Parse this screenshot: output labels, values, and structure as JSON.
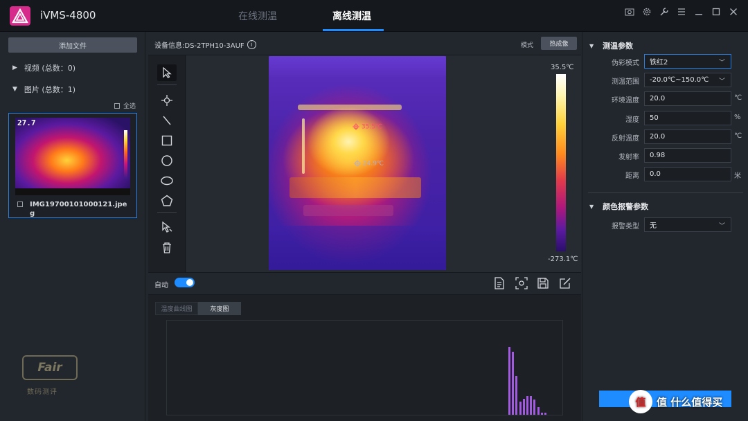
{
  "app": {
    "title": "iVMS-4800",
    "tabs": [
      {
        "label": "在线测温",
        "active": false
      },
      {
        "label": "离线测温",
        "active": true
      }
    ],
    "window_icons": [
      "camera-icon",
      "gear-icon",
      "wrench-icon",
      "menu-icon",
      "minimize-icon",
      "maximize-icon",
      "close-icon"
    ]
  },
  "left": {
    "add_file": "添加文件",
    "video_group": "视频 (总数：0)",
    "image_group": "图片 (总数：1)",
    "select_all": "全选",
    "thumbnail": {
      "temp": "27.7",
      "filename": "IMG19700101000121.jpeg"
    },
    "watermark": {
      "title": "Fair",
      "subtitle": "数码测评"
    }
  },
  "center": {
    "device_info": "设备信息:DS-2TPH10-3AUF",
    "mode_label": "模式",
    "thermal_button": "热成像",
    "scale": {
      "max": "35.5℃",
      "min": "-273.1℃"
    },
    "markers": [
      {
        "label": "35.5℃"
      },
      {
        "label": "24.9℃"
      }
    ],
    "auto_label": "自动",
    "auto_on": true,
    "hist_tabs": [
      "温度曲线图",
      "灰度图"
    ],
    "histogram_values": [
      72,
      67,
      41,
      14,
      17,
      20,
      20,
      16,
      8,
      2,
      2
    ]
  },
  "right": {
    "measure_title": "测温参数",
    "params": [
      {
        "label": "伪彩模式",
        "value": "铁红2",
        "type": "select",
        "unit": ""
      },
      {
        "label": "测温范围",
        "value": "-20.0℃~150.0℃",
        "type": "select",
        "unit": ""
      },
      {
        "label": "环境温度",
        "value": "20.0",
        "type": "input",
        "unit": "℃"
      },
      {
        "label": "湿度",
        "value": "50",
        "type": "input",
        "unit": "%"
      },
      {
        "label": "反射温度",
        "value": "20.0",
        "type": "input",
        "unit": "℃"
      },
      {
        "label": "发射率",
        "value": "0.98",
        "type": "input",
        "unit": ""
      },
      {
        "label": "距离",
        "value": "0.0",
        "type": "input",
        "unit": "米"
      }
    ],
    "alarm_title": "颜色报警参数",
    "alarm_label": "报警类型",
    "alarm_value": "无",
    "watermark_text": "值 什么值得买",
    "watermark_glyph": "值"
  }
}
